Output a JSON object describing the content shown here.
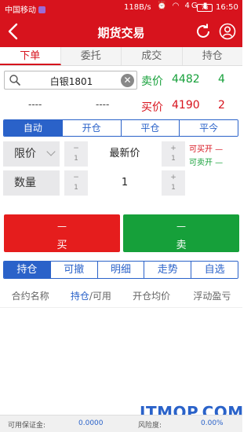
{
  "status_bar": {
    "carrier": "中国移动",
    "speed": "118B/s",
    "signal_icons": "⏰ ◠ 4G ▮",
    "battery": "73",
    "time": "16:50"
  },
  "header": {
    "title": "期货交易"
  },
  "tabs": [
    {
      "label": "下单",
      "active": true
    },
    {
      "label": "委托",
      "active": false
    },
    {
      "label": "成交",
      "active": false
    },
    {
      "label": "持仓",
      "active": false
    }
  ],
  "search": {
    "value": "白银1801"
  },
  "quote": {
    "sell_label": "卖价",
    "sell_price": "4482",
    "sell_qty": "4",
    "buy_label": "买价",
    "buy_price": "4190",
    "buy_qty": "2",
    "placeholder_left": "----",
    "placeholder_right": "----"
  },
  "order_type_segment": [
    {
      "label": "自动",
      "active": true
    },
    {
      "label": "开仓",
      "active": false
    },
    {
      "label": "平仓",
      "active": false
    },
    {
      "label": "平今",
      "active": false
    }
  ],
  "price_row": {
    "label": "限价",
    "minus_symbol": "−",
    "minus_step": "1",
    "value": "最新价",
    "plus_symbol": "+",
    "plus_step": "1"
  },
  "qty_row": {
    "label": "数量",
    "minus_symbol": "−",
    "minus_step": "1",
    "value": "1",
    "plus_symbol": "+",
    "plus_step": "1"
  },
  "availability": {
    "can_buy_open": "可买开 —",
    "can_sell_open": "可卖开 —"
  },
  "buttons": {
    "buy_price": "—",
    "buy_label": "买",
    "sell_price": "—",
    "sell_label": "卖"
  },
  "bottom_segment": [
    {
      "label": "持仓",
      "active": true
    },
    {
      "label": "可撤",
      "active": false
    },
    {
      "label": "明细",
      "active": false
    },
    {
      "label": "走势",
      "active": false
    },
    {
      "label": "自选",
      "active": false
    }
  ],
  "columns": {
    "c1": "合约名称",
    "c2_a": "持仓",
    "c2_b": "/可用",
    "c3": "开仓均价",
    "c4": "浮动盈亏"
  },
  "footer": {
    "margin_label": "可用保证金:",
    "margin_value": "0.0000",
    "risk_label": "风险度:",
    "risk_value": "0.00%"
  },
  "watermark": {
    "left": "ITMOP",
    "dot": ".",
    "right": "COM"
  },
  "colors": {
    "brand_red": "#d7131d",
    "buy_red": "#e51d1d",
    "sell_green": "#16a03a",
    "accent_blue": "#2a62c9"
  }
}
